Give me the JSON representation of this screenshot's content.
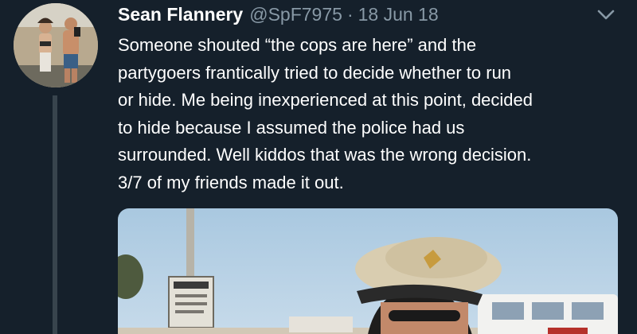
{
  "tweet": {
    "display_name": "Sean Flannery",
    "handle": "@SpF7975",
    "separator": "·",
    "date": "18 Jun 18",
    "text": "Someone shouted “the cops are here” and the\npartygoers frantically tried to decide whether to run\nor hide. Me being inexperienced at this point, decided\nto hide because I assumed the police had us\nsurrounded. Well kiddos that was the wrong decision.\n3/7 of my friends made it out."
  },
  "icons": {
    "more_menu": "chevron-down-icon"
  },
  "colors": {
    "background": "#15202b",
    "text": "#ffffff",
    "muted": "#8899a6",
    "thread_line": "#38444d"
  }
}
